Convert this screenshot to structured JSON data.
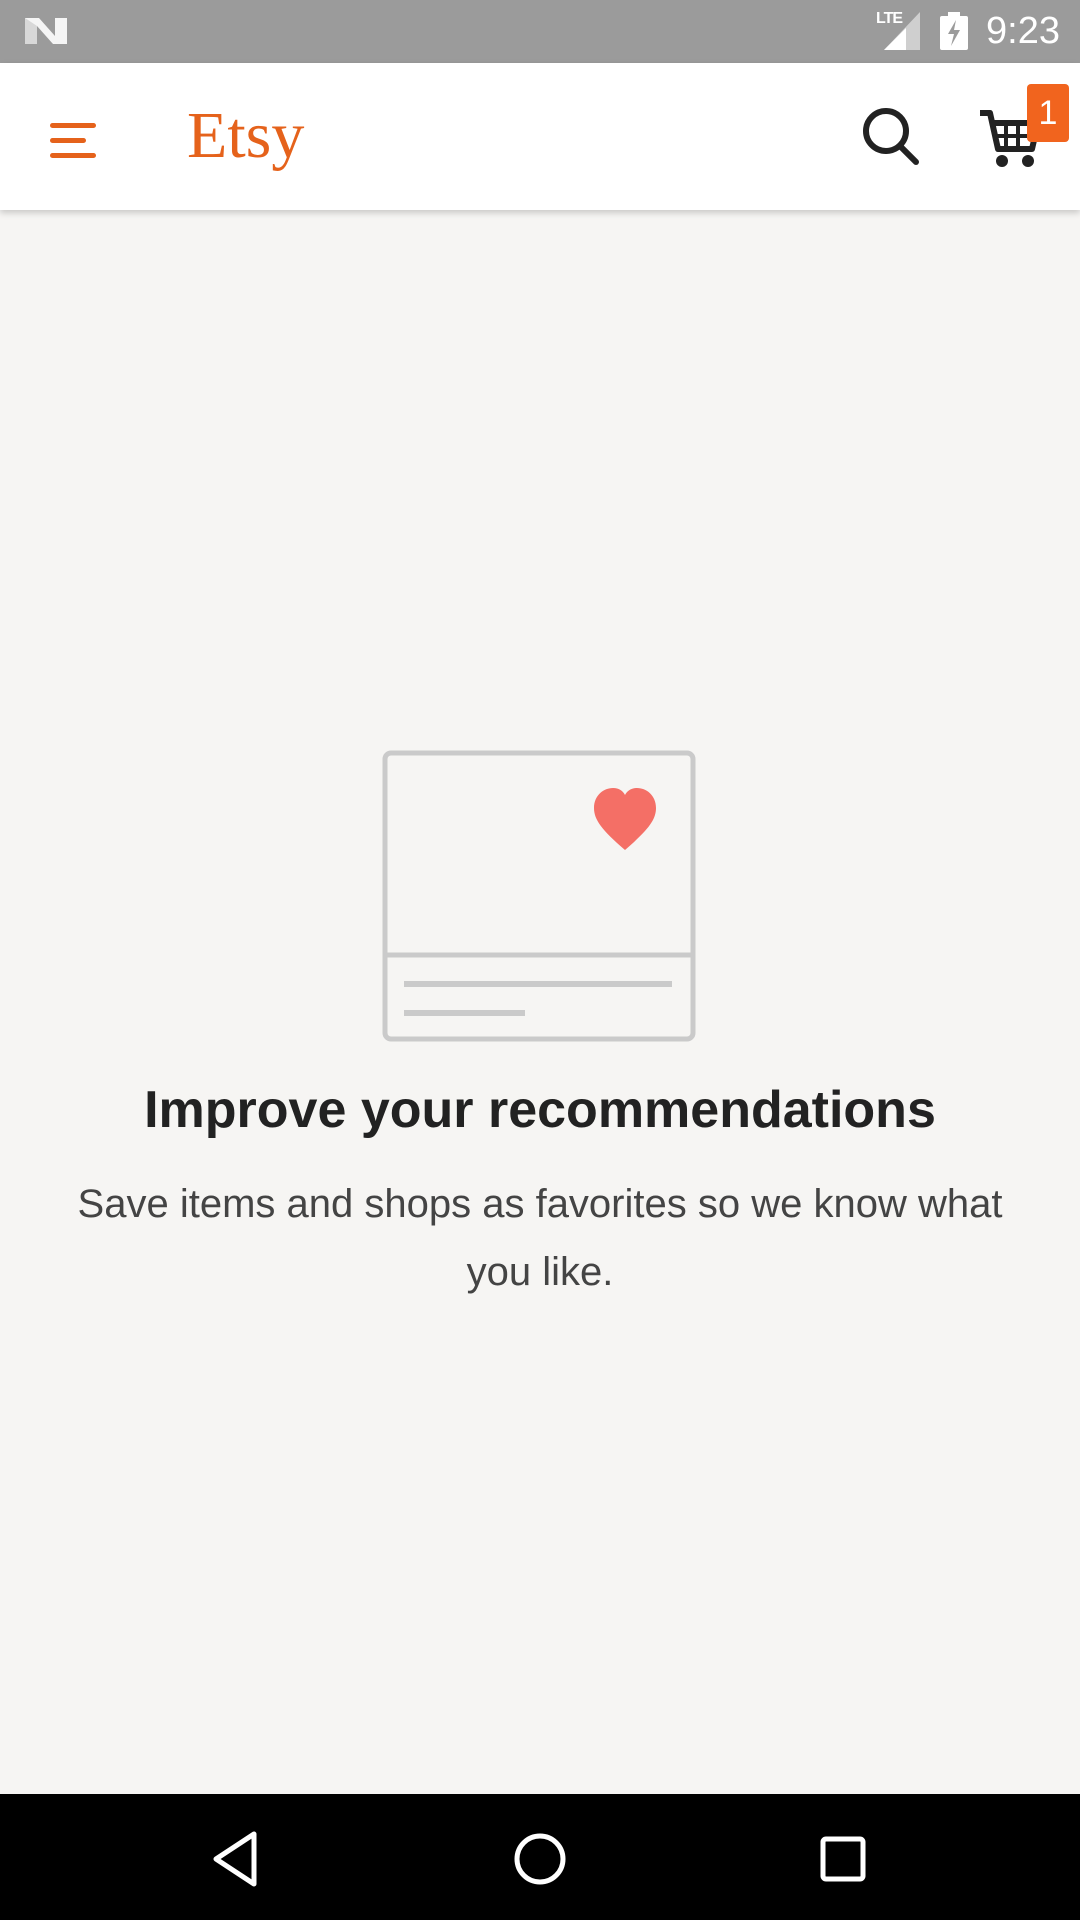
{
  "status_bar": {
    "network": "LTE",
    "time": "9:23"
  },
  "app_bar": {
    "logo_text": "Etsy",
    "cart_count": "1",
    "icons": [
      "menu-icon",
      "search-icon",
      "cart-icon"
    ],
    "accent_color": "#e5621b"
  },
  "empty_state": {
    "title": "Improve your recommendations",
    "subtitle": "Save items and shops as favorites so we know what you like.",
    "illustration_icon": "favorite-card-illustration",
    "heart_color": "#f46f66"
  },
  "nav_bar": {
    "icons": [
      "back-icon",
      "home-icon",
      "recents-icon"
    ]
  }
}
